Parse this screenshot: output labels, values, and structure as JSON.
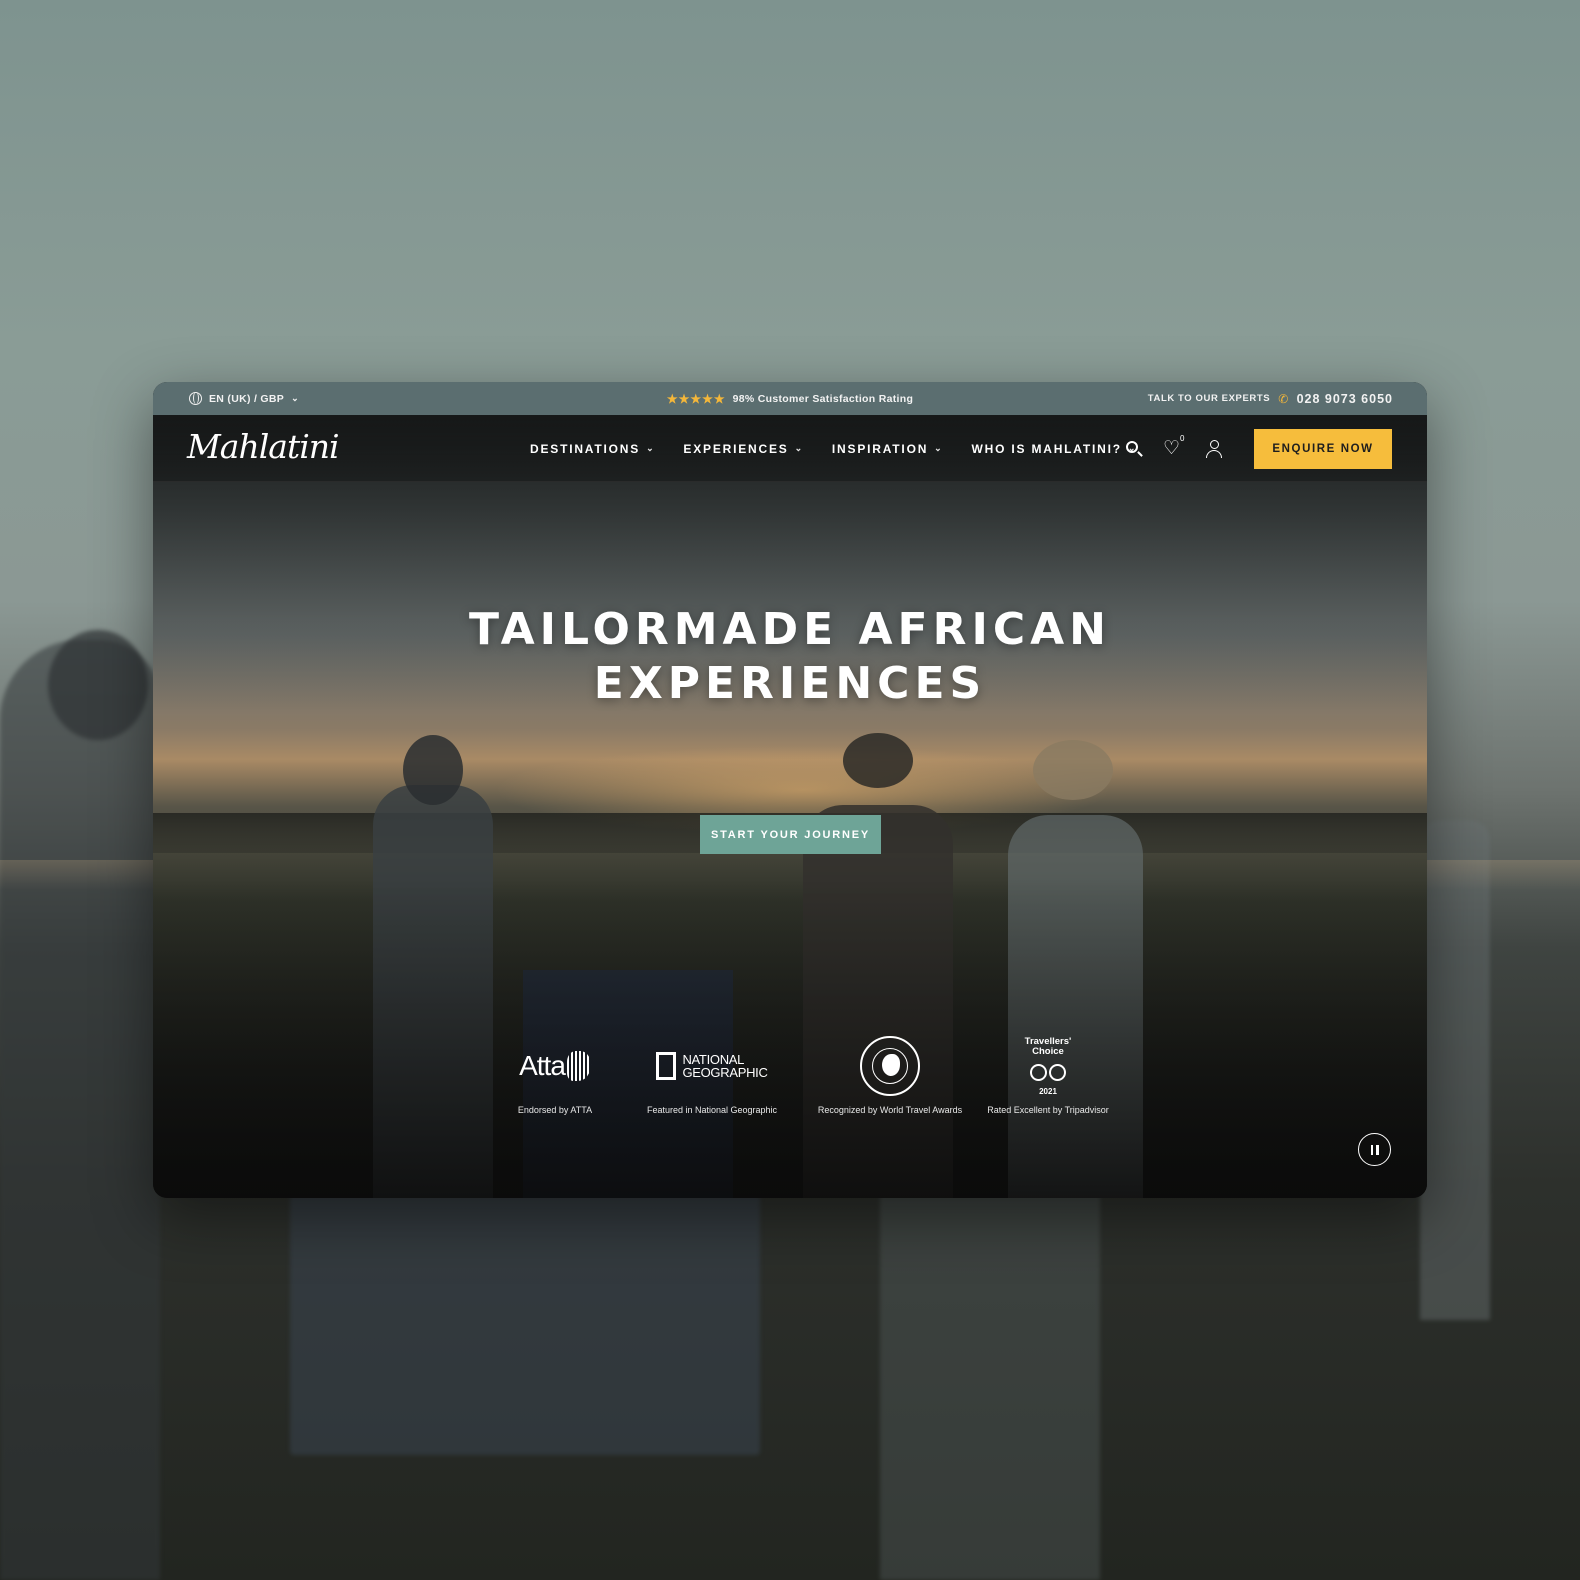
{
  "topbar": {
    "locale": "EN (UK) / GBP",
    "rating_stars": "★★★★★",
    "rating_text": "98% Customer Satisfaction Rating",
    "experts_label": "TALK TO OUR EXPERTS",
    "phone": "028 9073 6050"
  },
  "nav": {
    "logo": "Mahlatini",
    "items": [
      {
        "label": "DESTINATIONS"
      },
      {
        "label": "EXPERIENCES"
      },
      {
        "label": "INSPIRATION"
      },
      {
        "label": "WHO IS MAHLATINI?"
      }
    ],
    "wishlist_count": "0",
    "enquire_label": "ENQUIRE NOW"
  },
  "hero": {
    "title_line1": "TAILORMADE AFRICAN",
    "title_line2": "EXPERIENCES",
    "cta_label": "START YOUR JOURNEY"
  },
  "awards": [
    {
      "logo_text": "Atta",
      "caption": "Endorsed by ATTA"
    },
    {
      "logo_text_1": "NATIONAL",
      "logo_text_2": "GEOGRAPHIC",
      "caption": "Featured in National Geographic"
    },
    {
      "caption": "Recognized by World Travel Awards"
    },
    {
      "logo_text_1": "Travellers'",
      "logo_text_2": "Choice",
      "year": "2021",
      "caption": "Rated Excellent by Tripadvisor"
    }
  ],
  "colors": {
    "topbar_bg": "#5b6e70",
    "enquire_bg": "#f6bd3c",
    "cta_bg": "#6ea497",
    "star": "#f4b73a"
  }
}
